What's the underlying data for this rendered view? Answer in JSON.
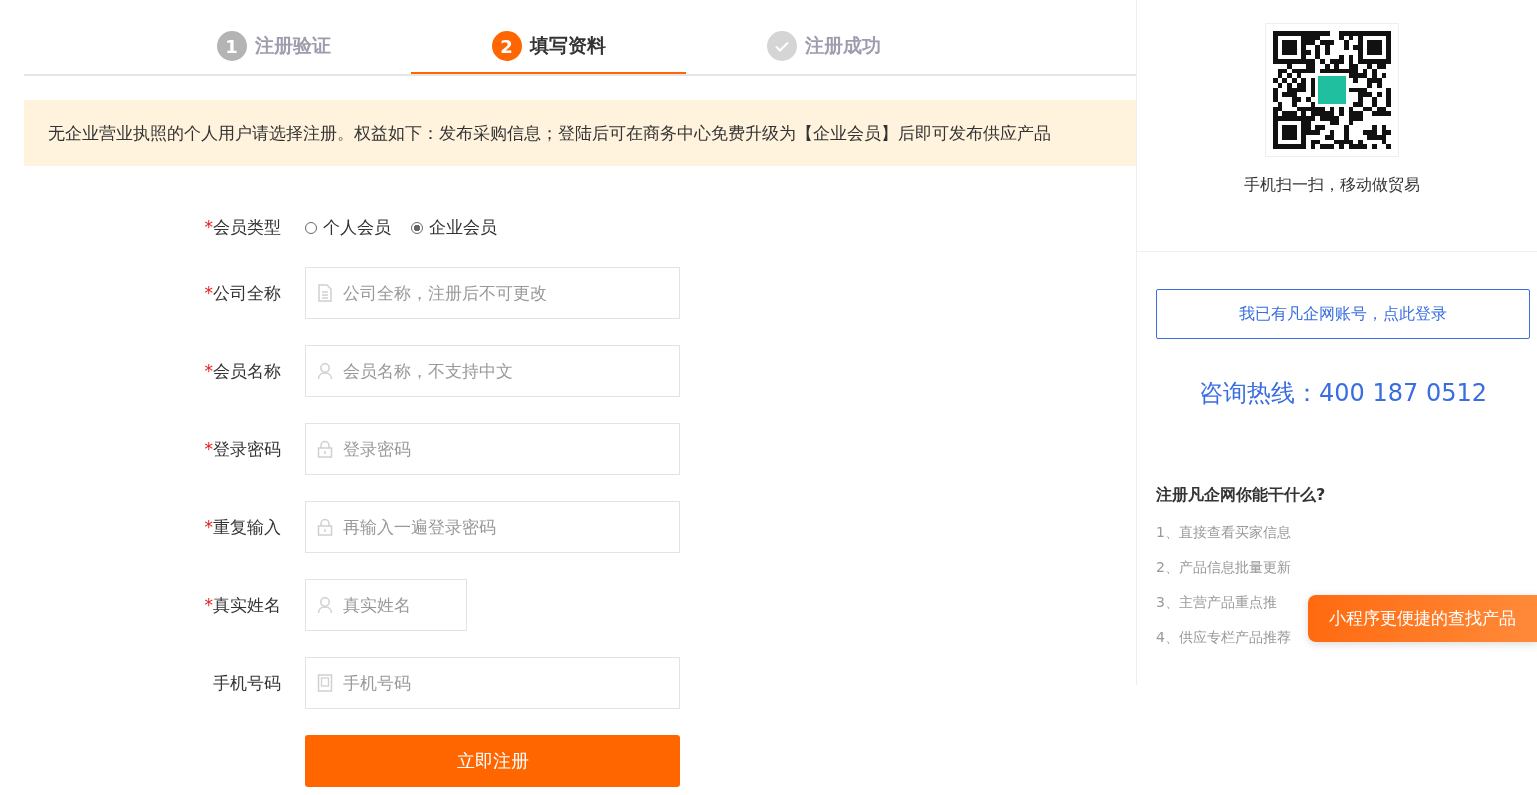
{
  "steps": [
    {
      "kind": "number",
      "number": "1",
      "label": "注册验证",
      "selected": false
    },
    {
      "kind": "number",
      "number": "2",
      "label": "填写资料",
      "selected": true
    },
    {
      "kind": "check",
      "label": "注册成功",
      "selected": false
    }
  ],
  "notice": "无企业营业执照的个人用户请选择注册。权益如下：发布采购信息；登陆后可在商务中心免费升级为【企业会员】后即可发布供应产品",
  "member_type": {
    "label": "会员类型",
    "mark": "*",
    "options": [
      {
        "label": "个人会员",
        "selected": false
      },
      {
        "label": "企业会员",
        "selected": true
      }
    ]
  },
  "fields": [
    {
      "label": "公司全称",
      "mark": "*",
      "kind": "document",
      "placeholder": "公司全称，注册后不可更改",
      "short": false
    },
    {
      "label": "会员名称",
      "mark": "*",
      "kind": "person",
      "placeholder": "会员名称，不支持中文",
      "short": false
    },
    {
      "label": "登录密码",
      "mark": "*",
      "kind": "lock",
      "placeholder": "登录密码",
      "short": false
    },
    {
      "label": "重复输入",
      "mark": "*",
      "kind": "lock",
      "placeholder": "再输入一遍登录密码",
      "short": false
    },
    {
      "label": "真实姓名",
      "mark": "*",
      "kind": "person",
      "placeholder": "真实姓名",
      "short": true
    },
    {
      "label": "手机号码",
      "kind": "phone",
      "placeholder": "手机号码",
      "short": false
    }
  ],
  "submit": "立即注册",
  "sidebar": {
    "qr_caption": "手机扫一扫，移动做贸易",
    "login_link": "我已有凡企网账号，点此登录",
    "hotline": "咨询热线：400 187 0512",
    "benefits_title": "注册凡企网你能干什么?",
    "benefits": [
      "1、直接查看买家信息",
      "2、产品信息批量更新",
      "3、主营产品重点推",
      "4、供应专栏产品推荐"
    ]
  },
  "float_button": "小程序更便捷的查找产品"
}
